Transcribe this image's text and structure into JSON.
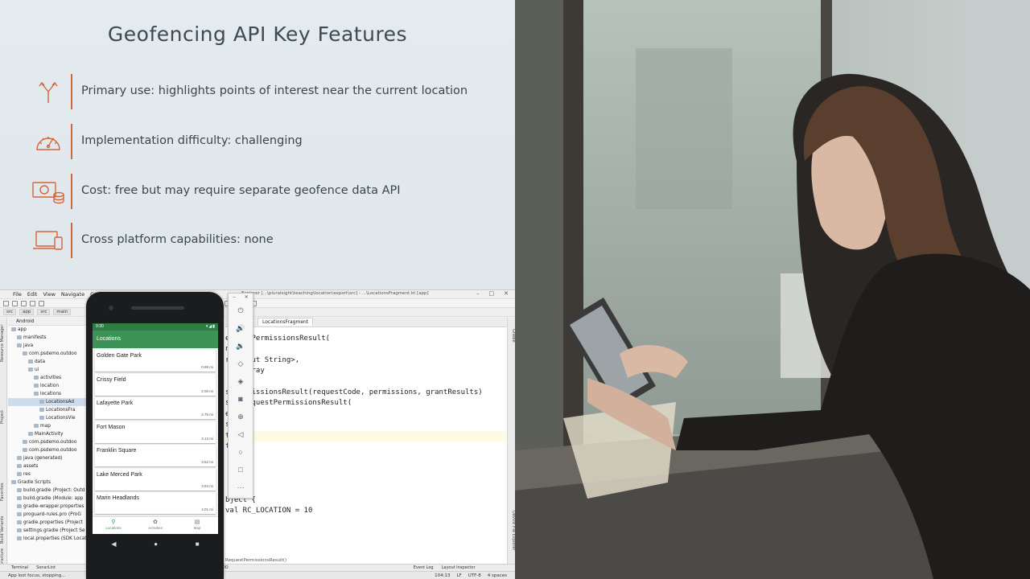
{
  "slide": {
    "title": "Geofencing API Key Features",
    "accent_color": "#d4643a",
    "features": [
      {
        "icon": "fork-arrows-icon",
        "text": "Primary use: highlights points of interest near the current location"
      },
      {
        "icon": "speedometer-icon",
        "text": "Implementation difficulty: challenging"
      },
      {
        "icon": "money-coins-icon",
        "text": "Cost: free but may require separate geofence data API"
      },
      {
        "icon": "laptop-phone-icon",
        "text": "Cross platform capabilities: none"
      }
    ]
  },
  "ide": {
    "menu": [
      "File",
      "Edit",
      "View",
      "Navigate",
      "Code"
    ],
    "window_title": "Explorer [...\\pluralsight\\teaching\\location\\export\\src] - ...\\LocationsFragment.kt [app]",
    "breadcrumbs": [
      "src",
      "app",
      "src",
      "main"
    ],
    "tab_label": "LocationsFragment",
    "tree_header": "Android",
    "tree": [
      {
        "label": "app",
        "depth": 0
      },
      {
        "label": "manifests",
        "depth": 1
      },
      {
        "label": "java",
        "depth": 1
      },
      {
        "label": "com.psdemo.outdoo",
        "depth": 2
      },
      {
        "label": "data",
        "depth": 3
      },
      {
        "label": "ui",
        "depth": 3
      },
      {
        "label": "activities",
        "depth": 4
      },
      {
        "label": "location",
        "depth": 4
      },
      {
        "label": "locations",
        "depth": 4
      },
      {
        "label": "LocationsAd",
        "depth": 5,
        "selected": true
      },
      {
        "label": "LocationsFra",
        "depth": 5
      },
      {
        "label": "LocationsVie",
        "depth": 5
      },
      {
        "label": "map",
        "depth": 4
      },
      {
        "label": "MainActivity",
        "depth": 3
      },
      {
        "label": "com.psdemo.outdoo",
        "depth": 2
      },
      {
        "label": "com.psdemo.outdoo",
        "depth": 2
      },
      {
        "label": "java (generated)",
        "depth": 1
      },
      {
        "label": "assets",
        "depth": 1
      },
      {
        "label": "res",
        "depth": 1
      },
      {
        "label": "Gradle Scripts",
        "depth": 0
      },
      {
        "label": "build.gradle (Project: Outd",
        "depth": 1
      },
      {
        "label": "build.gradle (Module: app",
        "depth": 1
      },
      {
        "label": "gradle-wrapper.properties",
        "depth": 1
      },
      {
        "label": "proguard-rules.pro (ProG",
        "depth": 1
      },
      {
        "label": "gradle.properties (Project",
        "depth": 1
      },
      {
        "label": "settings.gradle (Project Se",
        "depth": 1
      },
      {
        "label": "local.properties (SDK Locat",
        "depth": 1
      }
    ],
    "left_strip": [
      "Resource Manager",
      "Project",
      "Favorites",
      "Build Variants",
      "Structure"
    ],
    "right_strip": [
      "Gradle",
      "Device File Explorer"
    ],
    "code_lines": [
      "equestPermissionsResult(",
      "nt,",
      "rray<out String>,",
      " IntArray",
      "",
      "stPermissionsResult(requestCode, permissions, grantResults)",
      "s.onRequestPermissionsResult(",
      "e,",
      "s,",
      "ts,",
      "this",
      "",
      "",
      "",
      "",
      "bject {",
      "val RC_LOCATION = 10"
    ],
    "bottom_breadcrumb": "RequestPermissionsResult()",
    "bottom_tabs": [
      "Terminal",
      "SonarLint",
      "TODO"
    ],
    "bottom_right_tabs": [
      "Event Log",
      "Layout Inspector"
    ],
    "status_left": "App lost focus, stopping...",
    "status_right": [
      "104:13",
      "LF",
      "UTF-8",
      "4 spaces"
    ]
  },
  "phone": {
    "time": "9:30",
    "app_title": "Locations",
    "places": [
      {
        "name": "Golden Gate Park",
        "distance": "0.99 mi"
      },
      {
        "name": "Crissy Field",
        "distance": "2.00 mi"
      },
      {
        "name": "Lafayette Park",
        "distance": "2.75 mi"
      },
      {
        "name": "Fort Mason",
        "distance": "3.13 mi"
      },
      {
        "name": "Franklin Square",
        "distance": "3.52 mi"
      },
      {
        "name": "Lake Merced Park",
        "distance": "3.94 mi"
      },
      {
        "name": "Marin Headlands",
        "distance": "4.01 mi"
      }
    ],
    "nav": [
      {
        "label": "Locations",
        "icon": "pin-icon",
        "active": true
      },
      {
        "label": "Activities",
        "icon": "activities-icon",
        "active": false
      },
      {
        "label": "Map",
        "icon": "map-icon",
        "active": false
      }
    ],
    "brand_color": "#3c9356"
  },
  "emulator_controls": [
    "power-icon",
    "volume-up-icon",
    "volume-down-icon",
    "rotate-left-icon",
    "rotate-right-icon",
    "camera-icon",
    "zoom-icon",
    "back-icon",
    "home-icon",
    "overview-icon",
    "more-icon"
  ]
}
